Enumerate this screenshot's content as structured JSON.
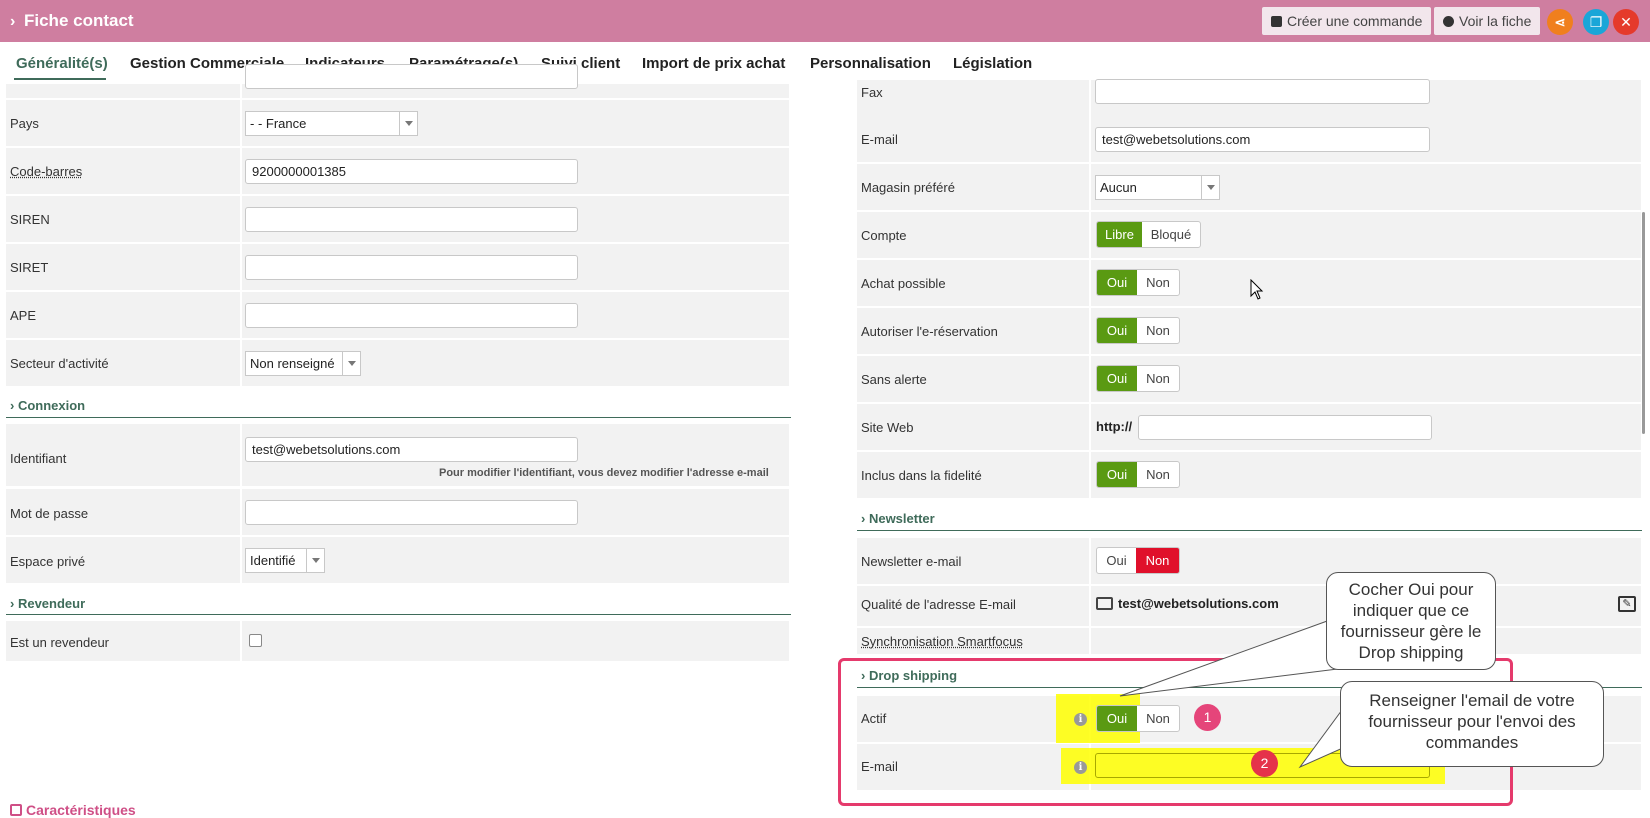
{
  "titlebar": {
    "title": "Fiche contact",
    "create_order": "Créer une commande",
    "view_sheet": "Voir la fiche",
    "share_icon": "share-icon",
    "copy_icon": "copy-icon",
    "close_icon": "close-icon"
  },
  "tabs": [
    "Généralité(s)",
    "Gestion Commerciale",
    "Indicateurs",
    "Paramétrage(s)",
    "Suivi client",
    "Import de prix achat",
    "Personnalisation",
    "Législation"
  ],
  "left": {
    "pays": {
      "label": "Pays",
      "value": "- - France"
    },
    "code_barres": {
      "label": "Code-barres",
      "value": "9200000001385"
    },
    "siren": {
      "label": "SIREN",
      "value": ""
    },
    "siret": {
      "label": "SIRET",
      "value": ""
    },
    "ape": {
      "label": "APE",
      "value": ""
    },
    "secteur": {
      "label": "Secteur d'activité",
      "value": "Non renseigné"
    },
    "connexion": "Connexion",
    "identifiant": {
      "label": "Identifiant",
      "value": "test@webetsolutions.com",
      "hint": "Pour modifier l'identifiant, vous devez modifier l'adresse e-mail"
    },
    "mot_de_passe": {
      "label": "Mot de passe",
      "value": ""
    },
    "espace_prive": {
      "label": "Espace privé",
      "value": "Identifié"
    },
    "revendeur": "Revendeur",
    "est_revendeur": {
      "label": "Est un revendeur",
      "checked": false
    },
    "caracteristiques": "Caractéristiques"
  },
  "right": {
    "fax": {
      "label": "Fax",
      "value": ""
    },
    "email": {
      "label": "E-mail",
      "value": "test@webetsolutions.com"
    },
    "magasin": {
      "label": "Magasin préféré",
      "value": "Aucun"
    },
    "compte": {
      "label": "Compte",
      "on": "Libre",
      "off": "Bloqué"
    },
    "achat": {
      "label": "Achat possible",
      "on": "Oui",
      "off": "Non"
    },
    "ereservation": {
      "label": "Autoriser l'e-réservation",
      "on": "Oui",
      "off": "Non"
    },
    "sans_alerte": {
      "label": "Sans alerte",
      "on": "Oui",
      "off": "Non"
    },
    "site_web": {
      "label": "Site Web",
      "prefix": "http://",
      "value": ""
    },
    "fidelite": {
      "label": "Inclus dans la fidelité",
      "on": "Oui",
      "off": "Non"
    },
    "newsletter_section": "Newsletter",
    "newsletter_email": {
      "label": "Newsletter e-mail",
      "on": "Oui",
      "off": "Non"
    },
    "qualite": {
      "label": "Qualité de l'adresse E-mail",
      "value": "test@webetsolutions.com"
    },
    "sync": {
      "label": "Synchronisation Smartfocus"
    },
    "drop_section": "Drop shipping",
    "actif": {
      "label": "Actif",
      "on": "Oui",
      "off": "Non"
    },
    "drop_email": {
      "label": "E-mail",
      "value": ""
    }
  },
  "annotations": {
    "callout1": "Cocher Oui pour indiquer que ce fournisseur gère le Drop shipping",
    "callout2": "Renseigner l'email de votre fournisseur pour l'envoi des commandes",
    "badge1": "1",
    "badge2": "2",
    "highlight_color": "#ffff00",
    "box_color": "#e53a6c"
  },
  "colors": {
    "header": "#cf7ea0",
    "accent": "#3f6b5a",
    "green": "#5a9a12",
    "red": "#e0102b",
    "orange": "#f07f1e",
    "cyan": "#1aa6d8"
  }
}
